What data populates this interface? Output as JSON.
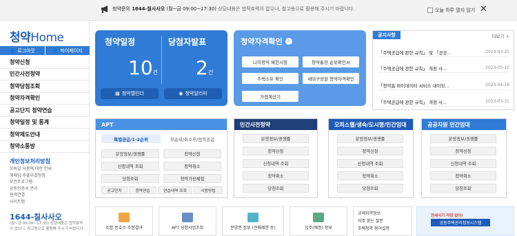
{
  "topbar": {
    "notice_prefix": "청약문의 ",
    "notice_phone": "1644-칠사사오",
    "notice_hours": "(월~금 09:00~17:30)",
    "notice_sub": " 상담내용은 법적효력이 없으니, 참고용으로 활용해 주시기 바랍니다.",
    "dont_show": "오늘 하루 열지 않기",
    "close": "✕"
  },
  "sidebar": {
    "logo_prefix": "청약",
    "logo_home": "Home",
    "login": "로그아웃",
    "mypage": "마이페이지",
    "menu": [
      "청약신청",
      "민간사전청약",
      "청약당첨조회",
      "청약자격확인",
      "공고단지 청약연습",
      "청약일정 및 통계",
      "청약제도안내",
      "청약소통방"
    ],
    "privacy_title": "개인정보처리방침",
    "sublinks": [
      "모바일 사용에 대한 안내",
      "해체업 추출부결정명",
      "보안프로그램",
      "공동인증서 관리",
      "원격연결",
      "사이트맵"
    ],
    "callcenter": "1644-칠사사오",
    "callcenter_sub": "(월~금 09:00~17:30) 상담내용은 법적효력이 없으니, 참고용으로 활용해 주시기 바랍니다."
  },
  "schedule_card": {
    "title_left": "청약일정",
    "title_right": "당첨자발표",
    "count_left": "10",
    "count_right": "2",
    "unit": "건",
    "btn_left": "청약캘린더",
    "btn_right": "청약알리미"
  },
  "qualify_card": {
    "title": "청약자격확인",
    "buttons": [
      "나의청약 제한사항",
      "청약통장 순위확인서",
      "주택소유 확인",
      "세대구성원 청약자격확인",
      "가점계산기"
    ]
  },
  "notices": {
    "tab": "공지사항",
    "more": "더보기",
    "items": [
      {
        "title": "「주택공급에 관한 규칙」 및 「공공...",
        "date": "2024-03-25"
      },
      {
        "title": "「주택공급에 관한 규칙」 개정 사...",
        "date": "2023-05-10"
      },
      {
        "title": "「청약홈 마이데이터 서비스 내이잉...",
        "date": "2023-04-18"
      },
      {
        "title": "「주택공급에 관한 규칙」 개정 사...",
        "date": "2023-03-31"
      }
    ]
  },
  "apt_panel": {
    "title": "APT",
    "seg_active": "특별공급/1·2순위",
    "seg_other": "무순위/취소후/임의공급",
    "buttons": [
      "분양정보/경쟁률",
      "청약신청",
      "신청내역 조회",
      "청약취소",
      "당첨조회",
      "청약가상체험"
    ],
    "small": [
      "공고단지",
      "청약연습",
      "연습내역 조회",
      "사용방법"
    ]
  },
  "panels": [
    {
      "title": "민간사전청약",
      "buttons": [
        "분양정보/경쟁률",
        "청약신청",
        "신청내역 조회",
        "청약취소",
        "당첨조회"
      ]
    },
    {
      "title": "오피스텔/생숙/도시형/민간임대",
      "buttons": [
        "분양정보/경쟁률",
        "청약신청",
        "신청내역 조회",
        "청약취소",
        "당첨조회"
      ]
    },
    {
      "title": "공공지원 민간임대",
      "buttons": [
        "분양정보/경쟁률",
        "청약신청",
        "신청내역 조회",
        "청약취소",
        "당첨조회"
      ]
    }
  ],
  "bottom": {
    "items": [
      "조합 등호수 추첨결과",
      "APT 당첨사업조회",
      "분양권 정보 (전매제한 등)",
      "입주(예정) 정보"
    ],
    "list": [
      "규제지역정보",
      "자주 묻는 질문",
      "주택청약 용어설명"
    ],
    "banner_line1": "전세사기 걱정 없이!",
    "banner_line2": "공동주택관리정보시스템"
  },
  "colors": {
    "primary": "#2f7bd6",
    "light": "#5a9ae6",
    "dark": "#1e5bb8",
    "navy": "#1f3f78"
  }
}
